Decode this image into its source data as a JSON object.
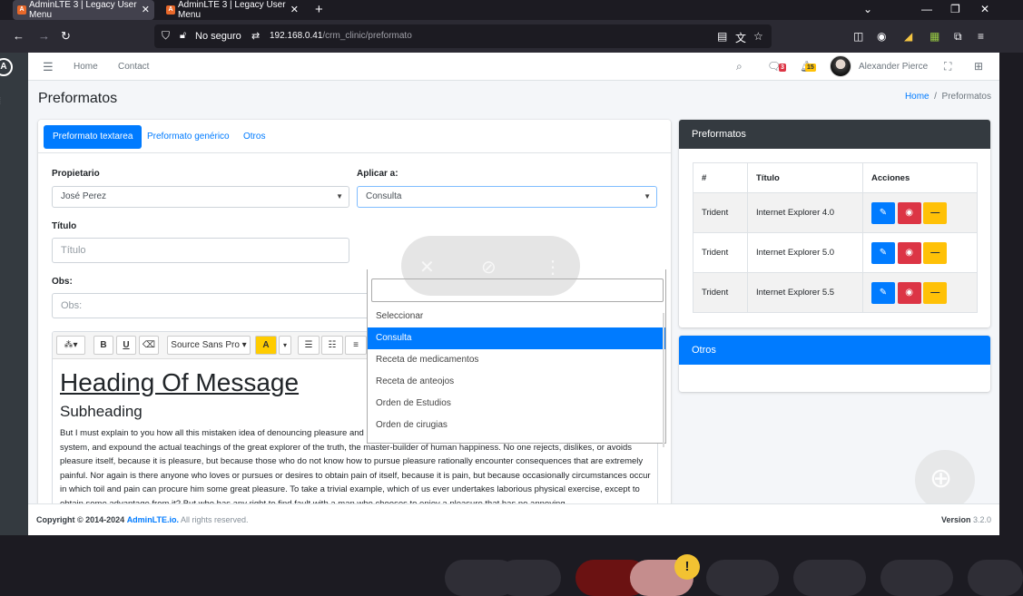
{
  "browser": {
    "tabs": [
      {
        "title": "AdminLTE 3 | Legacy User Menu",
        "active": true
      },
      {
        "title": "AdminLTE 3 | Legacy User Menu",
        "active": false
      }
    ],
    "new_tab_icon": "+",
    "window_controls": [
      "chevron-down-icon",
      "minimize-icon",
      "restore-icon",
      "close-icon"
    ],
    "security_label": "No seguro",
    "url_host": "192.168.0.41",
    "url_path": "/crm_clinic/preformato"
  },
  "navbar": {
    "links": [
      "Home",
      "Contact"
    ],
    "messages_badge": "3",
    "notifications_badge": "15",
    "user_name": "Alexander Pierce"
  },
  "page": {
    "title": "Preformatos",
    "breadcrumb": {
      "home": "Home",
      "current": "Preformatos"
    }
  },
  "form": {
    "tabs": [
      "Preformato textarea",
      "Preformato genérico",
      "Otros"
    ],
    "active_tab": "Preformato textarea",
    "owner_label": "Propietario",
    "owner_value": "José Perez",
    "apply_label": "Aplicar a:",
    "apply_value": "Consulta",
    "title_label": "Título",
    "title_placeholder": "Título",
    "obs_label": "Obs:",
    "obs_placeholder": "Obs:",
    "dropdown_options": [
      "Seleccionar",
      "Consulta",
      "Receta de medicamentos",
      "Receta de anteojos",
      "Orden de Estudios",
      "Orden de cirugias"
    ],
    "dropdown_selected": "Consulta"
  },
  "editor": {
    "toolbar": {
      "magic": "⁂▾",
      "bold": "B",
      "underline": "U",
      "eraser": "⌫",
      "font": "Source Sans Pro ▾",
      "color": "A",
      "color_caret": "▾",
      "ul": "☰",
      "ol": "☷",
      "align": "≡"
    },
    "heading": "Heading Of Message",
    "subheading": "Subheading",
    "body": "But I must explain to you how all this mistaken idea of denouncing pleasure and praising pain was born and I will give you a complete account of the system, and expound the actual teachings of the great explorer of the truth, the master-builder of human happiness. No one rejects, dislikes, or avoids pleasure itself, because it is pleasure, but because those who do not know how to pursue pleasure rationally encounter consequences that are extremely painful. Nor again is there anyone who loves or pursues or desires to obtain pain of itself, because it is pain, but because occasionally circumstances occur in which toil and pain can procure him some great pleasure. To take a trivial example, which of us ever undertakes laborious physical exercise, except to obtain some advantage from it? But who has any right to find fault with a man who chooses to enjoy a pleasure that has no annoying"
  },
  "preformatos_card": {
    "title": "Preformatos",
    "columns": [
      "#",
      "Título",
      "Acciones"
    ],
    "rows": [
      {
        "id": "Trident",
        "title": "Internet Explorer 4.0"
      },
      {
        "id": "Trident",
        "title": "Internet Explorer 5.0"
      },
      {
        "id": "Trident",
        "title": "Internet Explorer 5.5"
      }
    ],
    "action_icons": {
      "edit": "✎",
      "toggle": "◉",
      "remove": "—"
    }
  },
  "otros_card": {
    "title": "Otros"
  },
  "footer": {
    "copyright": "Copyright © 2014-2024",
    "brand": "AdminLTE.io.",
    "rights": "All rights reserved.",
    "version_label": "Version",
    "version": "3.2.0"
  },
  "colors": {
    "primary": "#007bff",
    "danger": "#dc3545",
    "warning": "#ffc107",
    "dark": "#343a40"
  }
}
